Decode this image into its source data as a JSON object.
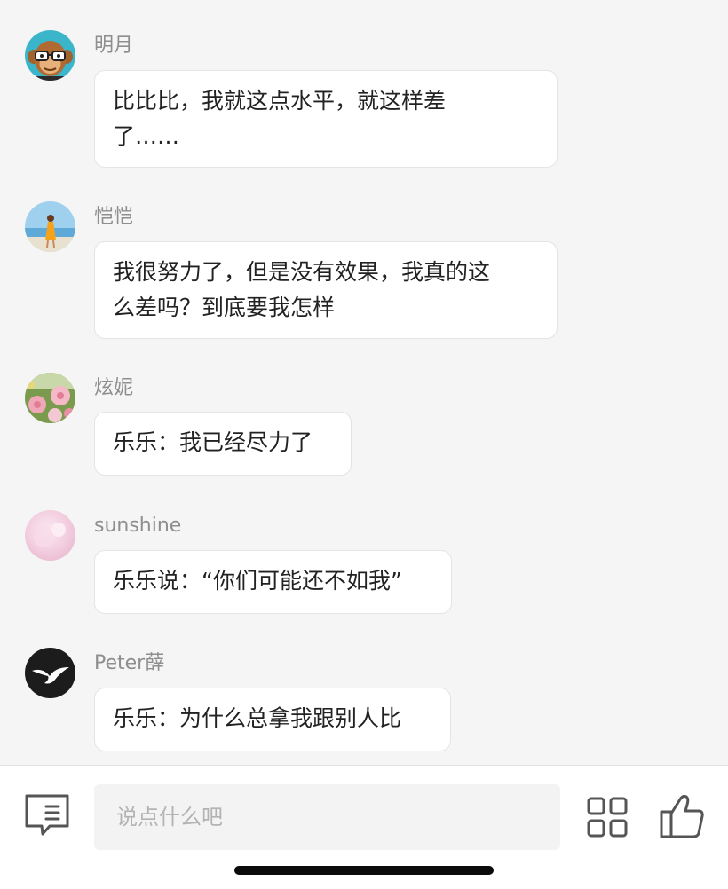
{
  "messages": [
    {
      "user": "明月",
      "avatar": "monkey-glasses-avatar",
      "lines": [
        "比比比，我就这点水平，就这样差",
        "了……"
      ]
    },
    {
      "user": "恺恺",
      "avatar": "beach-photo-avatar",
      "lines": [
        "我很努力了，但是没有效果，我真的这",
        "么差吗？到底要我怎样"
      ]
    },
    {
      "user": "炫妮",
      "avatar": "flowers-avatar",
      "lines": [
        "乐乐：我已经尽力了"
      ]
    },
    {
      "user": "sunshine",
      "avatar": "pink-blur-avatar",
      "lines": [
        "乐乐说：“你们可能还不如我”"
      ]
    },
    {
      "user": "Peter薛",
      "avatar": "bird-logo-avatar",
      "lines": [
        "乐乐：为什么总拿我跟别人比"
      ]
    }
  ],
  "input": {
    "placeholder": "说点什么吧"
  },
  "icons": {
    "comment": "comment-icon",
    "grid": "grid-icon",
    "like": "thumbs-up-icon"
  },
  "colors": {
    "background": "#f5f5f5",
    "bubble": "#ffffff",
    "username": "#8e8e8e",
    "text": "#222222"
  }
}
